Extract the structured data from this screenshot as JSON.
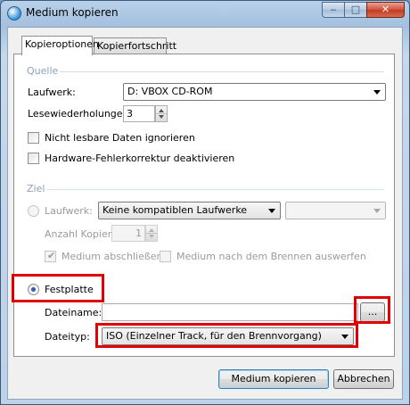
{
  "window": {
    "title": "Medium kopieren",
    "controls": {
      "minimize": "‒",
      "maximize": "□",
      "close": "✕"
    }
  },
  "tabs": [
    {
      "label": "Kopieroptionen",
      "active": true
    },
    {
      "label": "Kopierfortschritt",
      "active": false
    }
  ],
  "source": {
    "group_label": "Quelle",
    "drive_label": "Laufwerk:",
    "drive_value": "D: VBOX CD-ROM",
    "read_retries_label": "Lesewiederholungen:",
    "read_retries_value": "3",
    "ignore_unreadable_label": "Nicht lesbare Daten ignorieren",
    "disable_hw_correction_label": "Hardware-Fehlerkorrektur deaktivieren"
  },
  "target": {
    "group_label": "Ziel",
    "drive_label": "Laufwerk:",
    "drive_value": "Keine kompatiblen Laufwerke",
    "speed_value": "",
    "copies_label": "Anzahl Kopien:",
    "copies_value": "1",
    "finalize_label": "Medium abschließen",
    "eject_label": "Medium nach dem Brennen auswerfen",
    "harddisk_label": "Festplatte",
    "filename_label": "Dateiname:",
    "filename_value": "",
    "browse_label": "...",
    "filetype_label": "Dateityp:",
    "filetype_value": "ISO (Einzelner Track, für den Brennvorgang)"
  },
  "buttons": {
    "copy": "Medium kopieren",
    "cancel": "Abbrechen"
  },
  "colors": {
    "highlight": "#e00000",
    "group_label": "#8aa3c1",
    "radio_dot": "#2d5eb0"
  }
}
